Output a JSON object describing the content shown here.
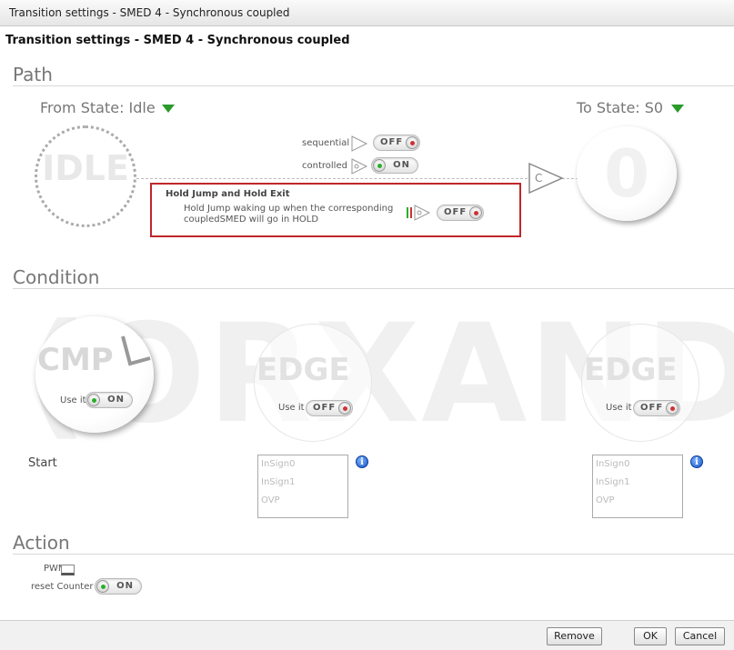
{
  "window": {
    "title": "Transition settings - SMED 4 - Synchronous coupled"
  },
  "dialog": {
    "heading": "Transition settings - SMED 4 - Synchronous coupled"
  },
  "watermark": "(ORXANDY",
  "path": {
    "title": "Path",
    "from_state_label": "From State: Idle",
    "to_state_label": "To State: S0",
    "from_circle_text": "IDLE",
    "to_circle_text": "0",
    "sequential": {
      "label": "sequential",
      "state": "OFF"
    },
    "controlled": {
      "label": "controlled",
      "state": "ON"
    },
    "node_label": "C",
    "hold": {
      "title": "Hold Jump and Hold Exit",
      "description_line1": "Hold Jump waking up when the corresponding",
      "description_line2": "coupledSMED will go in HOLD",
      "state": "OFF"
    }
  },
  "condition": {
    "title": "Condition",
    "cmp": {
      "text": "CMP",
      "use_label": "Use it",
      "state": "ON"
    },
    "edge1": {
      "text": "EDGE",
      "use_label": "Use it",
      "state": "OFF",
      "signals": [
        "InSign0",
        "InSign1",
        "OVP"
      ]
    },
    "edge2": {
      "text": "EDGE",
      "use_label": "Use it",
      "state": "OFF",
      "signals": [
        "InSign0",
        "InSign1",
        "OVP"
      ]
    },
    "start_label": "Start",
    "info_glyph": "i"
  },
  "action": {
    "title": "Action",
    "pwm_label": "PWM:",
    "reset_label": "reset Counter",
    "reset_state": "ON"
  },
  "footer": {
    "remove": "Remove",
    "ok": "OK",
    "cancel": "Cancel"
  },
  "colors": {
    "highlight": "#c0262c",
    "on": "#2ab02a",
    "off": "#cc3333",
    "info": "#1555c7"
  }
}
